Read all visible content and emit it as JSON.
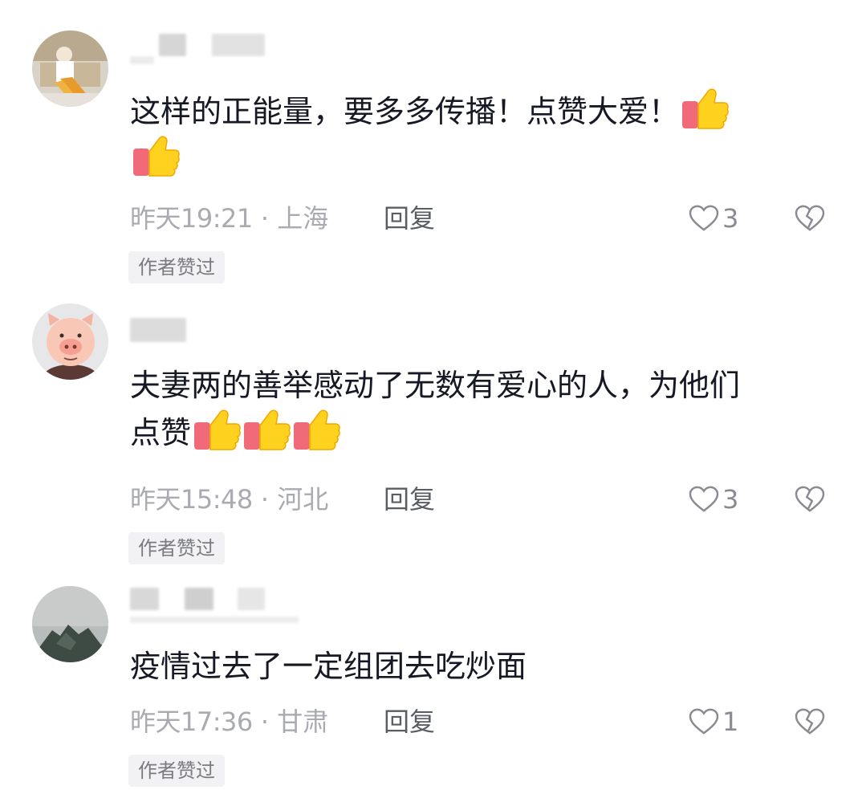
{
  "comments": [
    {
      "text": "这样的正能量，要多多传播！点赞大爱！",
      "time": "昨天19:21",
      "location": "上海",
      "reply_label": "回复",
      "likes": "3",
      "badge": "作者赞过"
    },
    {
      "text_line1": "夫妻两的善举感动了无数有爱心的人，为他们",
      "text_line2": "点赞",
      "time": "昨天15:48",
      "location": "河北",
      "reply_label": "回复",
      "likes": "3",
      "badge": "作者赞过"
    },
    {
      "text": "疫情过去了一定组团去吃炒面",
      "time": "昨天17:36",
      "location": "甘肃",
      "reply_label": "回复",
      "likes": "1",
      "badge": "作者赞过"
    }
  ],
  "separator": "·",
  "icons": {
    "like": "heart-outline-icon",
    "dislike": "broken-heart-icon",
    "emoji": "thumbs-up-emoji"
  },
  "colors": {
    "text": "#161823",
    "meta": "#a9abb1",
    "badge_bg": "#f2f2f4"
  }
}
